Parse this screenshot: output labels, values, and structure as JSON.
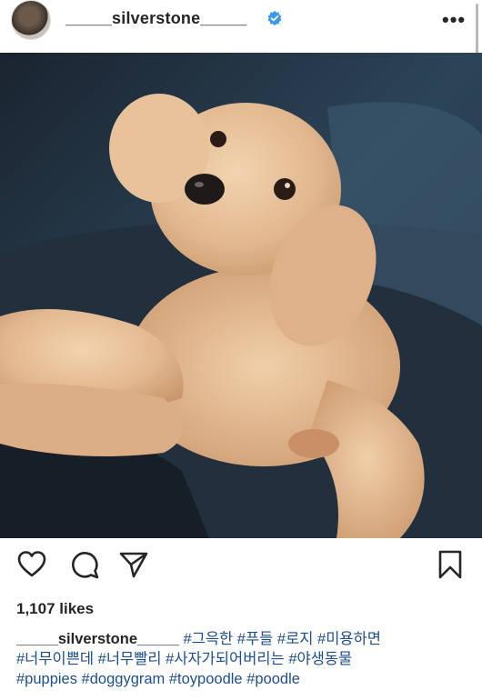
{
  "post": {
    "username": "_____silverstone_____",
    "verified": true,
    "more_icon": "more-horizontal-icon"
  },
  "photo": {
    "subject": "toy poodle photo"
  },
  "actions": {
    "like_icon": "heart-icon",
    "comment_icon": "comment-icon",
    "share_icon": "send-icon",
    "save_icon": "bookmark-icon"
  },
  "likes": "1,107 likes",
  "caption": {
    "username": "_____silverstone_____",
    "tags_line1": "#그윽한 #푸들 #로지 #미용하면",
    "tags_line2": "#너무이쁜데 #너무빨리 #사자가되어버리는 #야생동물",
    "tags_line3": "#puppies #doggygram #toypoodle #poodle"
  },
  "colors": {
    "verified": "#3897f0",
    "hashtag": "#1e4f8c",
    "text": "#262626"
  }
}
